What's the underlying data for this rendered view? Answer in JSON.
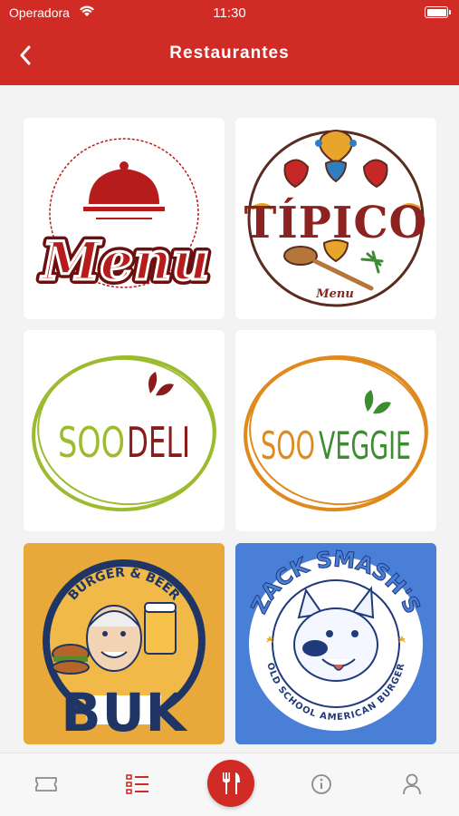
{
  "status_bar": {
    "carrier": "Operadora",
    "time": "11:30"
  },
  "header": {
    "title": "Restaurantes"
  },
  "restaurants": [
    {
      "name": "Menu",
      "logo_text": "Menu",
      "background": "#ffffff",
      "accent": "#b71c1c"
    },
    {
      "name": "Típico",
      "logo_text": "TÍPICO",
      "logo_sub": "Menu",
      "background": "#ffffff",
      "accent": "#8c2320"
    },
    {
      "name": "SooDeli",
      "logo_text_a": "SOO",
      "logo_text_b": "DELI",
      "background": "#ffffff",
      "accent": "#9dbb2e"
    },
    {
      "name": "SooVeggie",
      "logo_text_a": "SOO",
      "logo_text_b": "VEGGIE",
      "background": "#ffffff",
      "accent": "#e08a1e"
    },
    {
      "name": "BUK",
      "logo_text": "BUK",
      "logo_sub": "BURGER & BEER",
      "background": "#e8a93a",
      "accent": "#1f3566"
    },
    {
      "name": "Zack Smash's",
      "logo_text": "ZACK SMASH'S",
      "logo_sub": "OLD SCHOOL AMERICAN BURGER",
      "background": "#4a7fd8",
      "accent": "#1f3a7a"
    }
  ],
  "tabbar": {
    "items": [
      "ticket-icon",
      "list-icon",
      "fork-knife-icon",
      "info-icon",
      "user-icon"
    ],
    "active_color": "#d12b26",
    "inactive_color": "#8a8a8a"
  }
}
